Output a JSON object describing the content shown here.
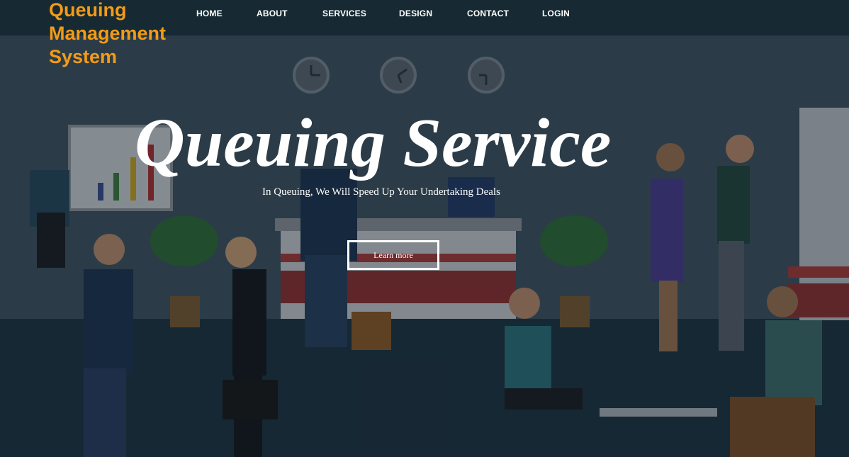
{
  "brand": {
    "line1": "Queuing",
    "line2": "Management",
    "line3": "System"
  },
  "nav": {
    "items": [
      {
        "label": "HOME"
      },
      {
        "label": "ABOUT"
      },
      {
        "label": "SERVICES"
      },
      {
        "label": "DESIGN"
      },
      {
        "label": "CONTACT"
      },
      {
        "label": "LOGIN"
      }
    ]
  },
  "hero": {
    "title": "Queuing Service",
    "subtitle": "In Queuing, We Will Speed Up Your Undertaking Deals",
    "button_label": "Learn more"
  },
  "colors": {
    "brand": "#f29b17",
    "header_bg": "#172a33",
    "text": "#ffffff"
  }
}
